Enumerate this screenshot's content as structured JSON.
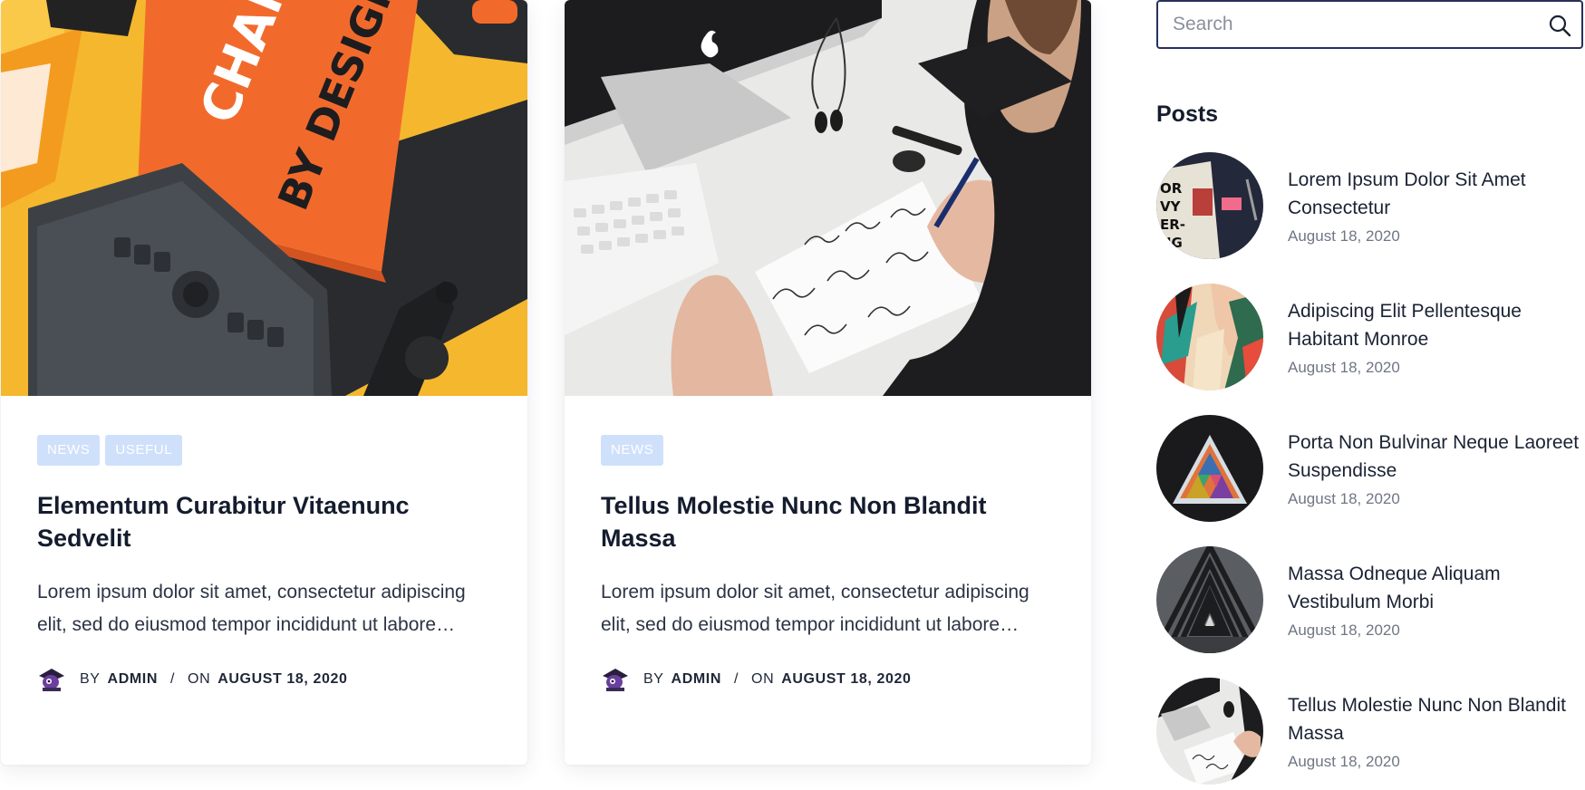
{
  "cards": [
    {
      "tags": [
        "NEWS",
        "USEFUL"
      ],
      "title": "Elementum Curabitur Vitaenunc Sedvelit",
      "excerpt": "Lorem ipsum dolor sit amet, consectetur adipiscing elit, sed do eiusmod tempor incididunt ut labore…",
      "meta": {
        "by": "BY",
        "author": "ADMIN",
        "sep": "/",
        "on": "ON",
        "date": "AUGUST 18, 2020"
      }
    },
    {
      "tags": [
        "NEWS"
      ],
      "title": "Tellus Molestie Nunc Non Blandit Massa",
      "excerpt": "Lorem ipsum dolor sit amet, consectetur adipiscing elit, sed do eiusmod tempor incididunt ut labore…",
      "meta": {
        "by": "BY",
        "author": "ADMIN",
        "sep": "/",
        "on": "ON",
        "date": "AUGUST 18, 2020"
      }
    }
  ],
  "sidebar": {
    "search": {
      "placeholder": "Search",
      "icon": "search-icon"
    },
    "posts_heading": "Posts",
    "posts": [
      {
        "title": "Lorem Ipsum Dolor Sit Amet Consectetur",
        "date": "August 18, 2020"
      },
      {
        "title": "Adipiscing Elit Pellentesque Habitant Monroe",
        "date": "August 18, 2020"
      },
      {
        "title": "Porta Non Bulvinar Neque Laoreet Suspendisse",
        "date": "August 18, 2020"
      },
      {
        "title": "Massa Odneque Aliquam Vestibulum Morbi",
        "date": "August 18, 2020"
      },
      {
        "title": "Tellus Molestie Nunc Non Blandit Massa",
        "date": "August 18, 2020"
      }
    ]
  },
  "colors": {
    "tag_bg": "#cfe0fb",
    "heading": "#141c2e",
    "search_border": "#27305a",
    "date": "#6f7684"
  }
}
